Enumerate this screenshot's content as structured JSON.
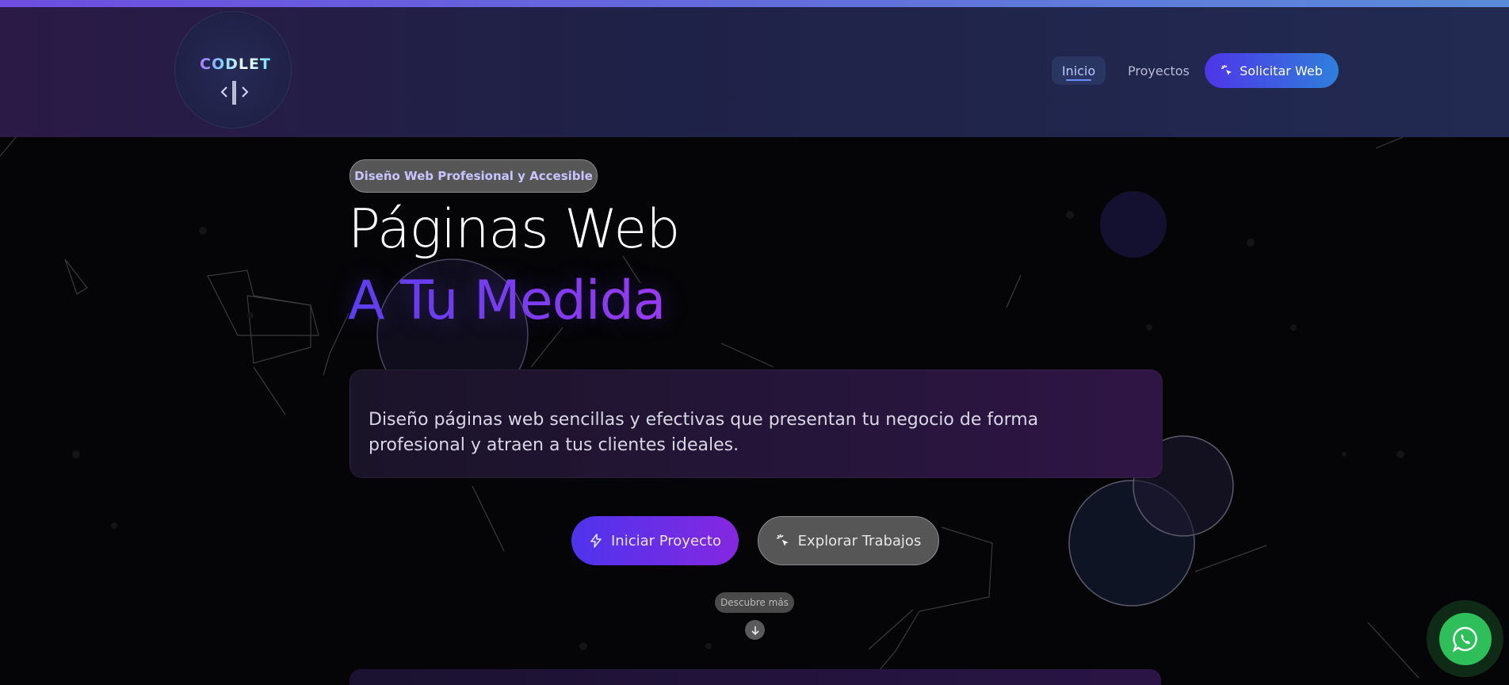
{
  "header": {
    "logo_text": "CODLET",
    "nav": {
      "inicio": "Inicio",
      "proyectos": "Proyectos",
      "solicitar": "Solicitar Web"
    }
  },
  "hero": {
    "badge": "Diseño Web Profesional y Accesible",
    "title_line1": "Páginas Web",
    "title_line2": "A Tu Medida",
    "description": "Diseño páginas web sencillas y efectivas que presentan tu negocio de forma profesional y atraen a tus clientes ideales.",
    "btn_iniciar": "Iniciar Proyecto",
    "btn_explorar": "Explorar Trabajos",
    "discover": "Descubre más"
  },
  "icons": {
    "solicitar": "sparkle-cursor-icon",
    "iniciar": "bolt-icon",
    "explorar": "sparkle-cursor-icon",
    "discover": "arrow-down-icon",
    "whatsapp": "whatsapp-icon"
  },
  "colors": {
    "accent": "#4e35e8",
    "accent_purple": "#8428e0",
    "whatsapp": "#2fbf5a",
    "header_bg": "#1f2147"
  }
}
